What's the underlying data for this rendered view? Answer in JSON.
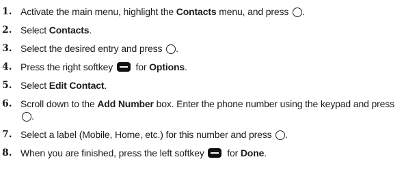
{
  "steps": [
    {
      "num": "1.",
      "parts": [
        {
          "t": "text",
          "v": "Activate the main menu, highlight the "
        },
        {
          "t": "bold",
          "v": "Contacts"
        },
        {
          "t": "text",
          "v": " menu, and press "
        },
        {
          "t": "icon",
          "v": "ok-icon"
        },
        {
          "t": "text",
          "v": "."
        }
      ]
    },
    {
      "num": "2.",
      "parts": [
        {
          "t": "text",
          "v": "Select "
        },
        {
          "t": "bold",
          "v": "Contacts"
        },
        {
          "t": "text",
          "v": "."
        }
      ]
    },
    {
      "num": "3.",
      "parts": [
        {
          "t": "text",
          "v": "Select the desired entry and press "
        },
        {
          "t": "icon",
          "v": "ok-icon"
        },
        {
          "t": "text",
          "v": "."
        }
      ]
    },
    {
      "num": "4.",
      "parts": [
        {
          "t": "text",
          "v": "Press the right softkey "
        },
        {
          "t": "icon",
          "v": "softkey-icon"
        },
        {
          "t": "text",
          "v": " for "
        },
        {
          "t": "bold",
          "v": "Options"
        },
        {
          "t": "text",
          "v": "."
        }
      ]
    },
    {
      "num": "5.",
      "parts": [
        {
          "t": "text",
          "v": "Select "
        },
        {
          "t": "bold",
          "v": "Edit Contact"
        },
        {
          "t": "text",
          "v": "."
        }
      ]
    },
    {
      "num": "6.",
      "parts": [
        {
          "t": "text",
          "v": "Scroll down to the "
        },
        {
          "t": "bold",
          "v": "Add Number"
        },
        {
          "t": "text",
          "v": " box. Enter the phone number using the keypad and press "
        },
        {
          "t": "icon",
          "v": "ok-icon"
        },
        {
          "t": "text",
          "v": "."
        }
      ]
    },
    {
      "num": "7.",
      "parts": [
        {
          "t": "text",
          "v": "Select a label (Mobile, Home, etc.) for this number and press "
        },
        {
          "t": "icon",
          "v": "ok-icon"
        },
        {
          "t": "text",
          "v": "."
        }
      ]
    },
    {
      "num": "8.",
      "parts": [
        {
          "t": "text",
          "v": "When you are finished, press the left softkey "
        },
        {
          "t": "icon",
          "v": "softkey-icon"
        },
        {
          "t": "text",
          "v": " for "
        },
        {
          "t": "bold",
          "v": "Done"
        },
        {
          "t": "text",
          "v": "."
        }
      ]
    }
  ]
}
